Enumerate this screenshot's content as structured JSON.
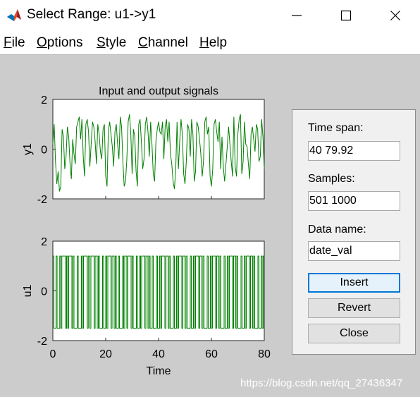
{
  "window": {
    "title": "Select Range: u1->y1"
  },
  "menu": {
    "file": {
      "m": "F",
      "rest": "ile"
    },
    "options": {
      "m": "O",
      "rest": "ptions"
    },
    "style": {
      "m": "S",
      "rest": "tyle"
    },
    "channel": {
      "m": "C",
      "rest": "hannel"
    },
    "help": {
      "m": "H",
      "rest": "elp"
    }
  },
  "chart_data": [
    {
      "type": "line",
      "title": "Input and output signals",
      "ylabel": "y1",
      "xlim": [
        0,
        80
      ],
      "ylim": [
        -2,
        2
      ],
      "yticks": [
        "-2",
        "0",
        "2"
      ],
      "line_color": "#008000",
      "series": [
        {
          "x": [
            0,
            0.5,
            1,
            1.5,
            2,
            2.5,
            3,
            3.5,
            4,
            4.5,
            5,
            5.5,
            6,
            6.5,
            7,
            7.5,
            8,
            8.5,
            9,
            9.5,
            10,
            10.5,
            11,
            11.5,
            12,
            12.5,
            13,
            13.5,
            14,
            14.5,
            15,
            15.5,
            16,
            16.5,
            17,
            17.5,
            18,
            18.5,
            19,
            19.5,
            20,
            20.5,
            21,
            21.5,
            22,
            22.5,
            23,
            23.5,
            24,
            24.5,
            25,
            25.5,
            26,
            26.5,
            27,
            27.5,
            28,
            28.5,
            29,
            29.5,
            30,
            30.5,
            31,
            31.5,
            32,
            32.5,
            33,
            33.5,
            34,
            34.5,
            35,
            35.5,
            36,
            36.5,
            37,
            37.5,
            38,
            38.5,
            39,
            39.5,
            40,
            40.5,
            41,
            41.5,
            42,
            42.5,
            43,
            43.5,
            44,
            44.5,
            45,
            45.5,
            46,
            46.5,
            47,
            47.5,
            48,
            48.5,
            49,
            49.5,
            50,
            50.5,
            51,
            51.5,
            52,
            52.5,
            53,
            53.5,
            54,
            54.5,
            55,
            55.5,
            56,
            56.5,
            57,
            57.5,
            58,
            58.5,
            59,
            59.5,
            60,
            60.5,
            61,
            61.5,
            62,
            62.5,
            63,
            63.5,
            64,
            64.5,
            65,
            65.5,
            66,
            66.5,
            67,
            67.5,
            68,
            68.5,
            69,
            69.5,
            70,
            70.5,
            71,
            71.5,
            72,
            72.5,
            73,
            73.5,
            74,
            74.5,
            75,
            75.5,
            76,
            76.5,
            77,
            77.5,
            78,
            78.5,
            79,
            79.5,
            80
          ],
          "y": [
            0.2,
            1.0,
            -0.5,
            -1.4,
            -0.9,
            -1.7,
            -1.5,
            0.8,
            0.5,
            -0.8,
            -0.3,
            0.9,
            0.5,
            -0.6,
            -1.2,
            0.4,
            -0.2,
            -0.6,
            0.9,
            1.1,
            1.3,
            0.4,
            1.2,
            -0.3,
            -1.1,
            1.0,
            1.2,
            0.7,
            -0.7,
            0.2,
            1.1,
            0.9,
            0.3,
            -0.6,
            1.0,
            0.6,
            -0.1,
            -0.4,
            0.8,
            1.0,
            -1.1,
            -1.5,
            0.7,
            1.1,
            0.6,
            0.1,
            -0.7,
            0.7,
            1.0,
            0.2,
            -0.4,
            1.3,
            0.9,
            -0.5,
            -1.5,
            -1.3,
            -0.4,
            1.1,
            1.4,
            0.6,
            -1.0,
            0.8,
            0.5,
            -0.9,
            -1.5,
            1.0,
            1.2,
            0.3,
            -0.8,
            -0.4,
            1.0,
            1.3,
            0.7,
            -0.3,
            1.1,
            0.2,
            -1.0,
            -1.3,
            0.3,
            0.8,
            1.1,
            0.7,
            0.6,
            1.1,
            -0.4,
            0.9,
            1.2,
            0.3,
            1.1,
            -0.2,
            -0.6,
            -1.3,
            -1.6,
            -0.8,
            1.1,
            -0.8,
            0.3,
            1.2,
            0.6,
            -1.0,
            -1.4,
            -0.5,
            1.0,
            0.8,
            -0.3,
            1.2,
            0.6,
            -1.3,
            -0.9,
            1.1,
            0.9,
            0.4,
            -0.2,
            -1.1,
            -0.5,
            1.1,
            1.3,
            0.6,
            0.9,
            -1.1,
            -1.5,
            -0.8,
            1.0,
            1.2,
            0.7,
            0.3,
            1.1,
            -0.8,
            0.5,
            -0.7,
            -1.3,
            -0.6,
            0.1,
            0.9,
            0.2,
            -0.5,
            -1.1,
            1.3,
            -0.7,
            -1.1,
            0.6,
            1.2,
            1.4,
            -1.0,
            -0.5,
            1.1,
            0.2,
            0.1,
            -0.6,
            -1.2,
            0.6,
            0.9,
            0.4,
            -0.1,
            1.0,
            0.8,
            -0.5,
            -0.3,
            1.2,
            0.5,
            -0.8
          ]
        }
      ]
    },
    {
      "type": "line",
      "xlabel": "Time",
      "ylabel": "u1",
      "xlim": [
        0,
        80
      ],
      "ylim": [
        -2,
        2
      ],
      "xticks": [
        "0",
        "20",
        "40",
        "60",
        "80"
      ],
      "yticks": [
        "-2",
        "0",
        "2"
      ],
      "line_color": "#008000",
      "levels": [
        -1.5,
        1.4
      ],
      "series": [
        {
          "x": [
            0,
            0.4,
            0.4,
            1.2,
            1.2,
            1.6,
            1.6,
            2.6,
            2.6,
            3.0,
            3.0,
            3.4,
            3.4,
            4.8,
            4.8,
            5.2,
            5.2,
            5.6,
            5.6,
            6.0,
            6.0,
            7.2,
            7.2,
            7.6,
            7.6,
            8.0,
            8.0,
            9.2,
            9.2,
            9.6,
            9.6,
            10.8,
            10.8,
            11.2,
            11.2,
            11.6,
            11.6,
            13.0,
            13.0,
            13.4,
            13.4,
            14.0,
            14.0,
            14.4,
            14.4,
            15.6,
            15.6,
            16.0,
            16.0,
            16.8,
            16.8,
            17.2,
            17.2,
            17.6,
            17.6,
            18.8,
            18.8,
            19.2,
            19.2,
            20.0,
            20.0,
            20.4,
            20.4,
            20.8,
            20.8,
            22.0,
            22.0,
            22.4,
            22.4,
            23.2,
            23.2,
            23.6,
            23.6,
            24.0,
            24.0,
            24.8,
            24.8,
            25.2,
            25.2,
            26.4,
            26.4,
            26.8,
            26.8,
            27.2,
            27.2,
            28.0,
            28.0,
            28.4,
            28.4,
            29.6,
            29.6,
            30.0,
            30.0,
            30.4,
            30.4,
            31.6,
            31.6,
            32.0,
            32.0,
            32.8,
            32.8,
            33.2,
            33.2,
            33.6,
            33.6,
            34.8,
            34.8,
            35.2,
            35.2,
            36.0,
            36.0,
            36.4,
            36.4,
            36.8,
            36.8,
            37.6,
            37.6,
            38.0,
            38.0,
            39.2,
            39.2,
            39.6,
            39.6,
            40.4,
            40.4,
            40.8,
            40.8,
            41.2,
            41.2,
            42.4,
            42.4,
            42.8,
            42.8,
            43.6,
            43.6,
            44.0,
            44.0,
            44.4,
            44.4,
            45.6,
            45.6,
            46.0,
            46.0,
            46.8,
            46.8,
            47.2,
            47.2,
            47.6,
            47.6,
            48.8,
            48.8,
            49.2,
            49.2,
            50.0,
            50.0,
            50.4,
            50.4,
            50.8,
            50.8,
            52.0,
            52.0,
            52.4,
            52.4,
            53.2,
            53.2,
            53.6,
            53.6,
            54.0,
            54.0,
            55.2,
            55.2,
            55.6,
            55.6,
            56.4,
            56.4,
            56.8,
            56.8,
            57.2,
            57.2,
            58.4,
            58.4,
            58.8,
            58.8,
            59.6,
            59.6,
            60.0,
            60.0,
            60.4,
            60.4,
            61.6,
            61.6,
            62.0,
            62.0,
            62.8,
            62.8,
            63.2,
            63.2,
            63.6,
            63.6,
            64.8,
            64.8,
            65.2,
            65.2,
            66.0,
            66.0,
            66.4,
            66.4,
            66.8,
            66.8,
            68.0,
            68.0,
            68.4,
            68.4,
            69.2,
            69.2,
            69.6,
            69.6,
            70.0,
            70.0,
            71.2,
            71.2,
            71.6,
            71.6,
            72.4,
            72.4,
            72.8,
            72.8,
            73.2,
            73.2,
            74.4,
            74.4,
            74.8,
            74.8,
            75.6,
            75.6,
            76.0,
            76.0,
            76.4,
            76.4,
            77.6,
            77.6,
            78.0,
            78.0,
            78.8,
            78.8,
            79.2,
            79.2,
            79.6,
            79.6,
            80
          ],
          "y": [
            1.4,
            1.4,
            -1.5,
            -1.5,
            1.4,
            1.4,
            -1.5,
            -1.5,
            1.4,
            1.4,
            -1.5,
            -1.5,
            1.4,
            1.4,
            -1.5,
            -1.5,
            1.4,
            1.4,
            -1.5,
            -1.5,
            1.4,
            1.4,
            -1.5,
            -1.5,
            1.4,
            1.4,
            -1.5,
            -1.5,
            1.4,
            1.4,
            -1.5,
            -1.5,
            1.4,
            1.4,
            -1.5,
            -1.5,
            1.4,
            1.4,
            -1.5,
            -1.5,
            1.4,
            1.4,
            -1.5,
            -1.5,
            1.4,
            1.4,
            -1.5,
            -1.5,
            1.4,
            1.4,
            -1.5,
            -1.5,
            1.4,
            1.4,
            -1.5,
            -1.5,
            1.4,
            1.4,
            -1.5,
            -1.5,
            1.4,
            1.4,
            -1.5,
            -1.5,
            1.4,
            1.4,
            -1.5,
            -1.5,
            1.4,
            1.4,
            -1.5,
            -1.5,
            1.4,
            1.4,
            -1.5,
            -1.5,
            1.4,
            1.4,
            -1.5,
            -1.5,
            1.4,
            1.4,
            -1.5,
            -1.5,
            1.4,
            1.4,
            -1.5,
            -1.5,
            1.4,
            1.4,
            -1.5,
            -1.5,
            1.4,
            1.4,
            -1.5,
            -1.5,
            1.4,
            1.4,
            -1.5,
            -1.5,
            1.4,
            1.4,
            -1.5,
            -1.5,
            1.4,
            1.4,
            -1.5,
            -1.5,
            1.4,
            1.4,
            -1.5,
            -1.5,
            1.4,
            1.4,
            -1.5,
            -1.5,
            1.4,
            1.4,
            -1.5,
            -1.5,
            1.4,
            1.4,
            -1.5,
            -1.5,
            1.4,
            1.4,
            -1.5,
            -1.5,
            1.4,
            1.4,
            -1.5,
            -1.5,
            1.4,
            1.4,
            -1.5,
            -1.5,
            1.4,
            1.4,
            -1.5,
            -1.5,
            1.4,
            1.4,
            -1.5,
            -1.5,
            1.4,
            1.4,
            -1.5,
            -1.5,
            1.4,
            1.4,
            -1.5,
            -1.5,
            1.4,
            1.4,
            -1.5,
            -1.5,
            1.4,
            1.4,
            -1.5,
            -1.5,
            1.4,
            1.4,
            -1.5,
            -1.5,
            1.4,
            1.4,
            -1.5,
            -1.5,
            1.4,
            1.4,
            -1.5,
            -1.5,
            1.4,
            1.4,
            -1.5,
            -1.5,
            1.4,
            1.4,
            -1.5,
            -1.5,
            1.4,
            1.4,
            -1.5,
            -1.5,
            1.4,
            1.4,
            -1.5,
            -1.5,
            1.4,
            1.4,
            -1.5,
            -1.5,
            1.4,
            1.4,
            -1.5,
            -1.5,
            1.4,
            1.4,
            -1.5,
            -1.5,
            1.4,
            1.4,
            -1.5,
            -1.5,
            1.4,
            1.4,
            -1.5,
            -1.5,
            1.4,
            1.4,
            -1.5,
            -1.5,
            1.4,
            1.4,
            -1.5,
            -1.5,
            1.4,
            1.4,
            -1.5,
            -1.5,
            1.4,
            1.4,
            -1.5,
            -1.5,
            1.4,
            1.4,
            -1.5,
            -1.5,
            1.4,
            1.4,
            -1.5,
            -1.5,
            1.4,
            1.4,
            -1.5,
            -1.5,
            1.4,
            1.4,
            -1.5,
            -1.5,
            1.4,
            1.4,
            -1.5,
            -1.5,
            1.4,
            1.4,
            -1.5,
            -1.5,
            1.4,
            1.4
          ]
        }
      ]
    }
  ],
  "panel": {
    "time_span_label": "Time span:",
    "time_span_value": "40 79.92",
    "samples_label": "Samples:",
    "samples_value": "501 1000",
    "data_name_label": "Data name:",
    "data_name_value": "date_val",
    "insert_label": "Insert",
    "revert_label": "Revert",
    "close_label": "Close"
  },
  "watermark": "https://blog.csdn.net/qq_27436347",
  "colors": {
    "signal": "#008000",
    "figure_bg": "#cccccc",
    "panel_bg": "#f0f0f0",
    "focus": "#0078d7"
  }
}
